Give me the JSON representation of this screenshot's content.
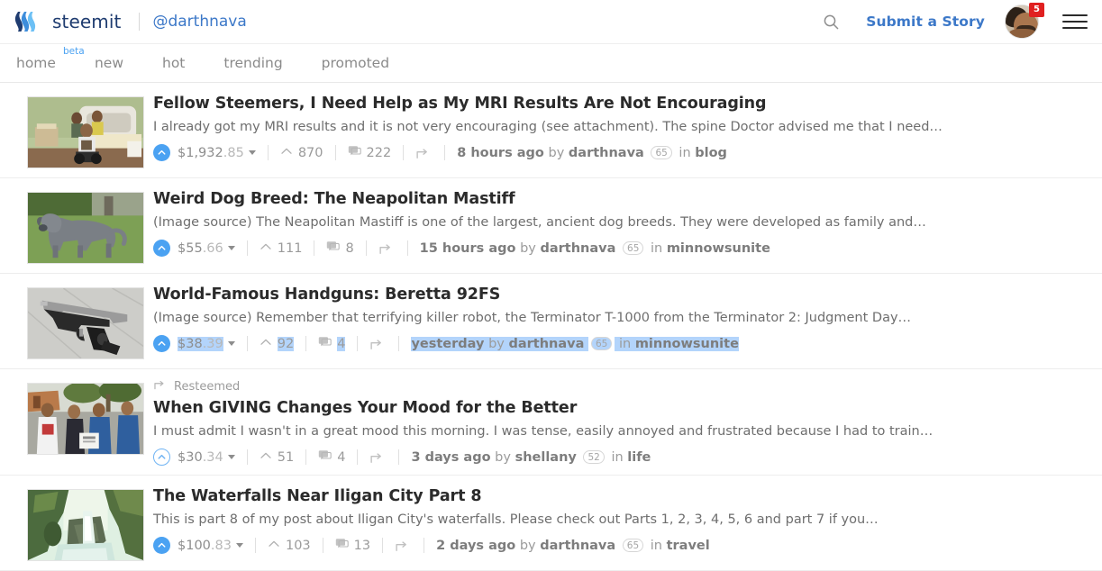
{
  "header": {
    "brand_name": "steemit",
    "brand_beta": "beta",
    "username": "@darthnava",
    "submit_label": "Submit a Story",
    "notification_count": "5",
    "search_icon": "search-icon",
    "menu_icon": "hamburger-icon",
    "logo_icon": "steemit-logo-icon",
    "colors": {
      "brand_blue": "#3c78c8",
      "accent_blue": "#4ba2f2",
      "logo_dark": "#1f3c70",
      "badge_red": "#e02020",
      "selection_blue": "#b3d4fb"
    }
  },
  "nav": {
    "items": [
      {
        "label": "home"
      },
      {
        "label": "new"
      },
      {
        "label": "hot"
      },
      {
        "label": "trending"
      },
      {
        "label": "promoted"
      }
    ]
  },
  "posts": [
    {
      "title": "Fellow Steemers, I Need Help as My MRI Results Are Not Encouraging",
      "summary": "I already got my MRI results and it is not very encouraging (see attachment). The spine Doctor advised me that I need…",
      "payout_dollars": "$1,932",
      "payout_cents": ".85",
      "votes": "870",
      "comments": "222",
      "time": "8 hours ago",
      "by_label": "by",
      "author": "darthnava",
      "reputation": "65",
      "in_label": "in",
      "category": "blog",
      "voted": true,
      "resteemed": false,
      "selected": false,
      "thumb": "mri-room-photo"
    },
    {
      "title": "Weird Dog Breed: The Neapolitan Mastiff",
      "summary": "(Image source) The Neapolitan Mastiff is one of the largest, ancient dog breeds. They were developed as family and…",
      "payout_dollars": "$55",
      "payout_cents": ".66",
      "votes": "111",
      "comments": "8",
      "time": "15 hours ago",
      "by_label": "by",
      "author": "darthnava",
      "reputation": "65",
      "in_label": "in",
      "category": "minnowsunite",
      "voted": true,
      "resteemed": false,
      "selected": false,
      "thumb": "gray-dog-photo"
    },
    {
      "title": "World-Famous Handguns: Beretta 92FS",
      "summary": "(Image source) Remember that terrifying killer robot, the Terminator T-1000 from the Terminator 2: Judgment Day…",
      "payout_dollars": "$38",
      "payout_cents": ".39",
      "votes": "92",
      "comments": "4",
      "time": "yesterday",
      "by_label": "by",
      "author": "darthnava",
      "reputation": "65",
      "in_label": "in",
      "category": "minnowsunite",
      "voted": true,
      "resteemed": false,
      "selected": true,
      "thumb": "handgun-photo"
    },
    {
      "title": "When GIVING Changes Your Mood for the Better",
      "summary": "I must admit I wasn't in a great mood this morning. I was tense, easily annoyed and frustrated because I had to train…",
      "payout_dollars": "$30",
      "payout_cents": ".34",
      "votes": "51",
      "comments": "4",
      "time": "3 days ago",
      "by_label": "by",
      "author": "shellany",
      "reputation": "52",
      "in_label": "in",
      "category": "life",
      "voted": false,
      "resteemed": true,
      "resteem_label": "Resteemed",
      "selected": false,
      "thumb": "group-people-photo"
    },
    {
      "title": "The Waterfalls Near Iligan City Part 8",
      "summary": "This is part 8 of my post about Iligan City's waterfalls. Please check out Parts 1, 2, 3, 4, 5, 6 and part 7 if you…",
      "payout_dollars": "$100",
      "payout_cents": ".83",
      "votes": "103",
      "comments": "13",
      "time": "2 days ago",
      "by_label": "by",
      "author": "darthnava",
      "reputation": "65",
      "in_label": "in",
      "category": "travel",
      "voted": true,
      "resteemed": false,
      "selected": false,
      "thumb": "waterfall-photo"
    }
  ]
}
